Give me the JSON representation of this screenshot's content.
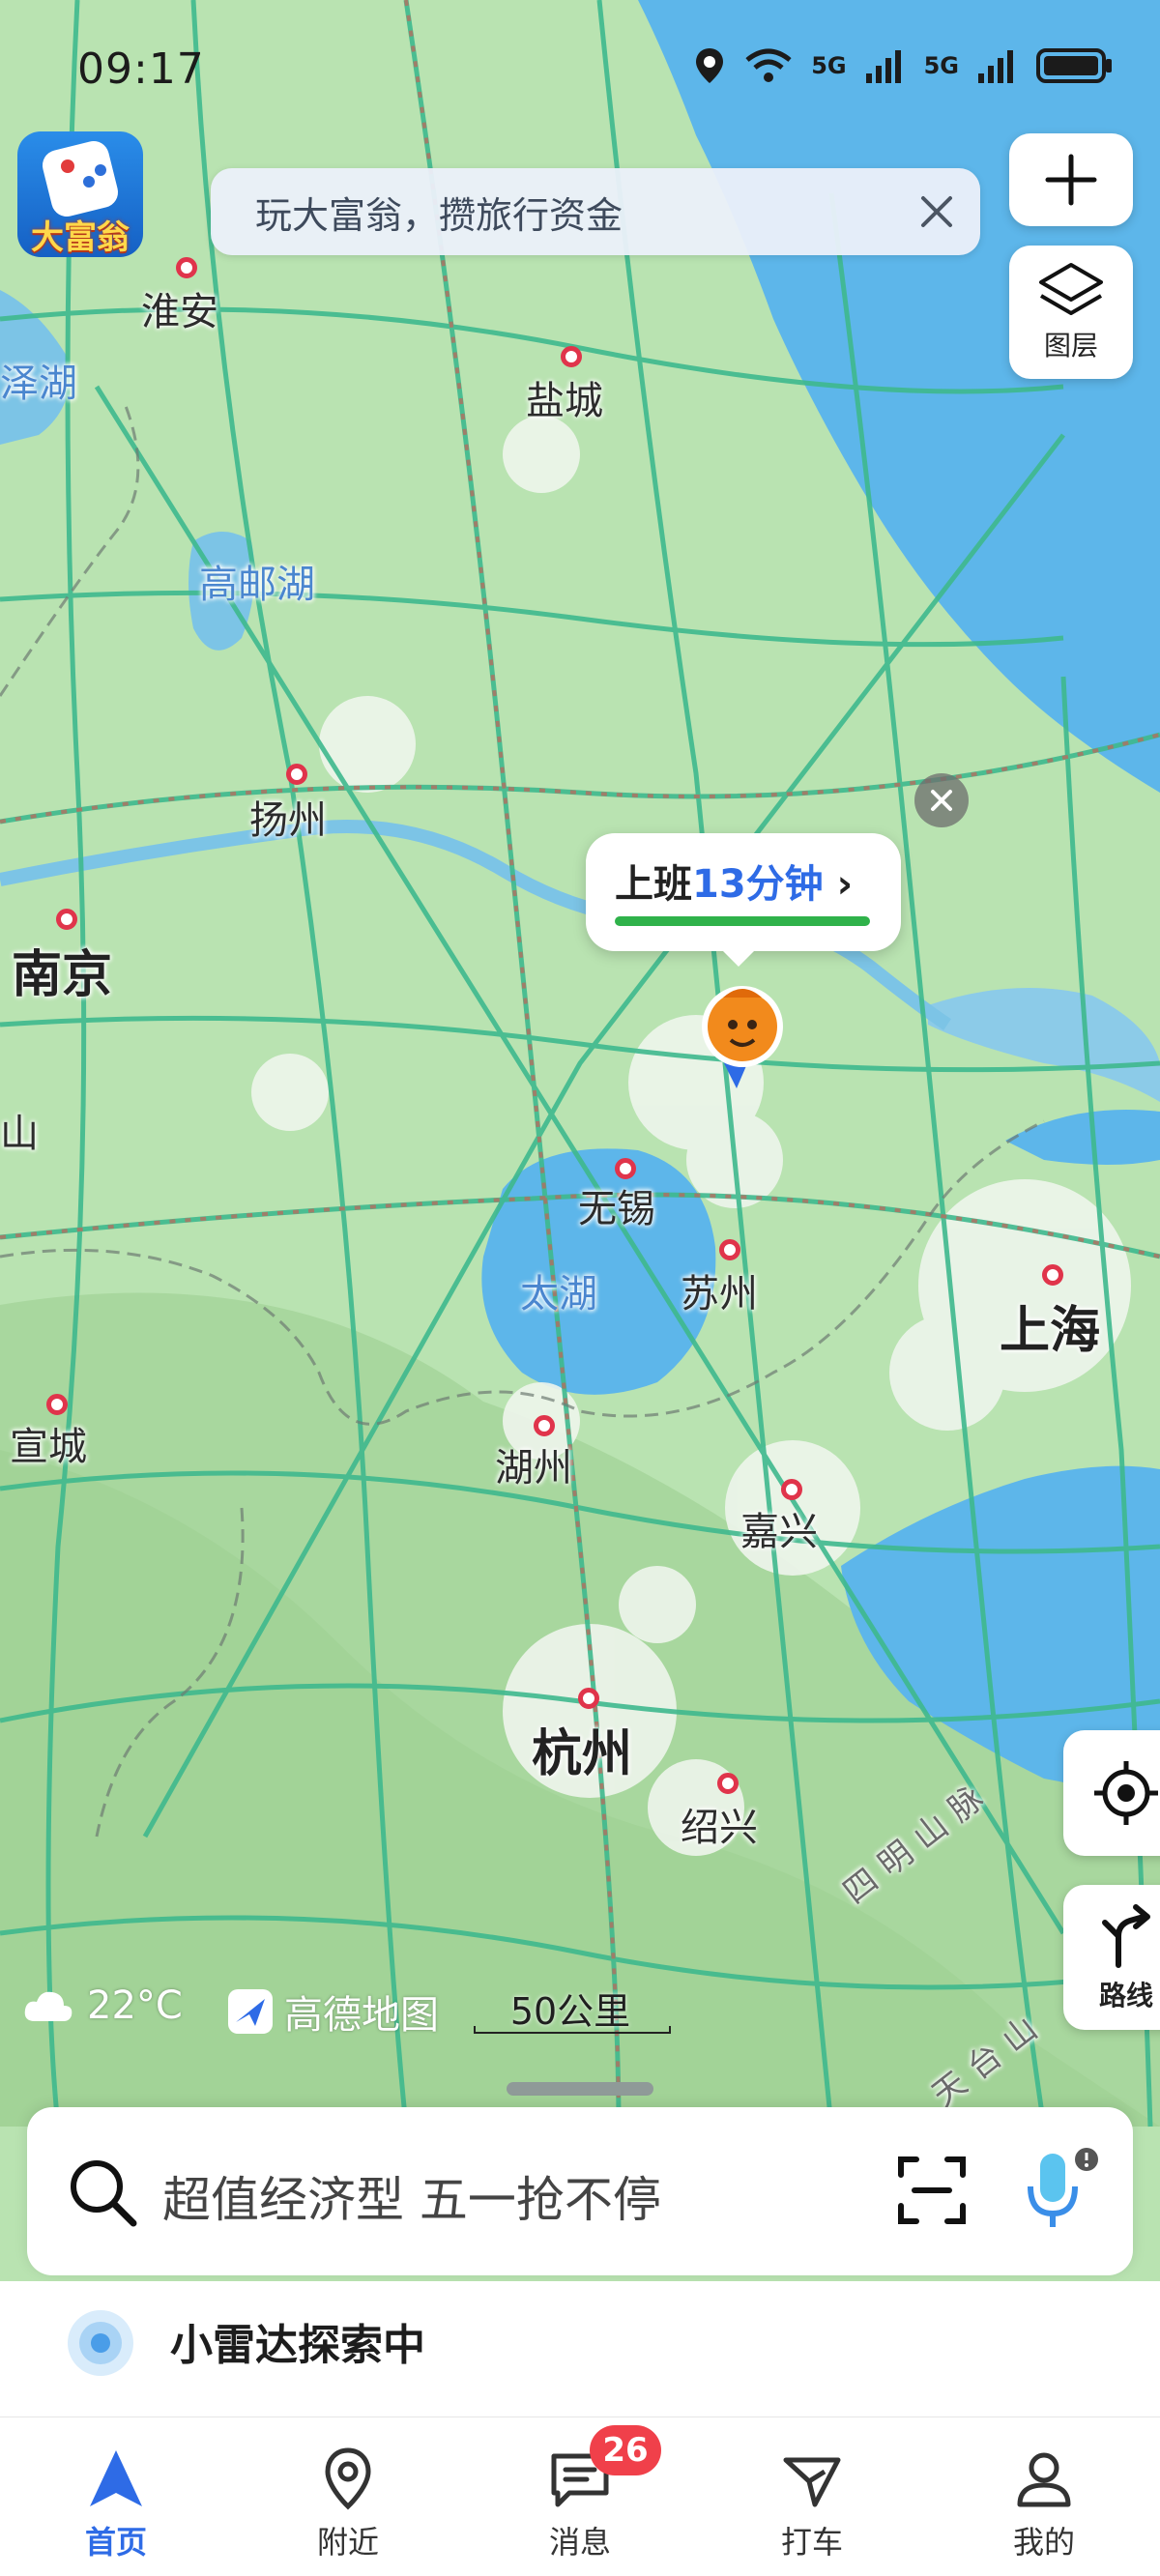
{
  "status_bar": {
    "time": "09:17",
    "network_1": "5G",
    "network_2": "5G"
  },
  "promo": {
    "label": "大富翁"
  },
  "banner": {
    "text": "玩大富翁，攒旅行资金"
  },
  "map_controls": {
    "zoom_in": "+",
    "layers_label": "图层",
    "route_label": "路线"
  },
  "commute": {
    "prefix": "上班",
    "time": "13分钟"
  },
  "map_labels": {
    "huaian": "淮安",
    "zehu": "泽湖",
    "yancheng": "盐城",
    "gaoyouhu": "高邮湖",
    "yangzhou": "扬州",
    "nanjing": "南京",
    "shan": "山",
    "wuxi": "无锡",
    "taihu": "太湖",
    "suzhou": "苏州",
    "shanghai": "上海",
    "xuancheng": "宣城",
    "huzhou": "湖州",
    "jiaxing": "嘉兴",
    "hangzhou": "杭州",
    "shaoxing": "绍兴",
    "simingshan": "四明山脉",
    "tiantaishan": "天台山"
  },
  "weather": {
    "temp": "22°C"
  },
  "brand": {
    "name": "高德地图"
  },
  "scale": {
    "label": "50公里"
  },
  "search": {
    "placeholder": "超值经济型 五一抢不停"
  },
  "radar": {
    "text": "小雷达探索中"
  },
  "tabbar": {
    "tabs": [
      {
        "label": "首页",
        "icon": "home-icon"
      },
      {
        "label": "附近",
        "icon": "location-pin-icon"
      },
      {
        "label": "消息",
        "icon": "message-icon"
      },
      {
        "label": "打车",
        "icon": "taxi-icon"
      },
      {
        "label": "我的",
        "icon": "profile-icon"
      }
    ],
    "message_badge": "26"
  },
  "colors": {
    "land": "#b7e2b3",
    "water": "#5db6ea",
    "road": "#3fb98e",
    "accent": "#2e6be6",
    "badge": "#f0404a"
  }
}
